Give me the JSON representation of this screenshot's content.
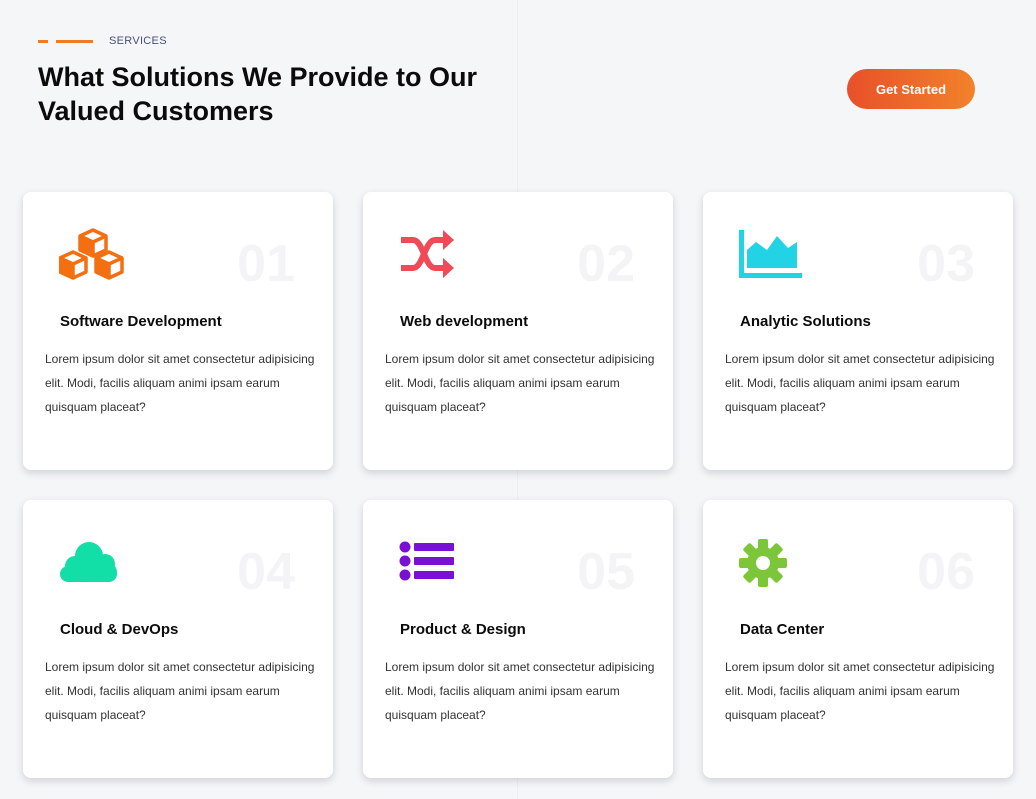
{
  "header": {
    "eyebrow": "SERVICES",
    "title": "What Solutions We Provide to Our Valued Customers",
    "cta_label": "Get Started"
  },
  "colors": {
    "accent": "#f07b22",
    "cta_gradient": [
      "#e8502a",
      "#f2822a"
    ]
  },
  "services": [
    {
      "number": "01",
      "title": "Software Development",
      "description": "Lorem ipsum dolor sit amet consectetur adipisicing elit. Modi, facilis aliquam animi ipsam earum quisquam placeat?",
      "icon": "cubes-icon",
      "icon_color": "#f36f10"
    },
    {
      "number": "02",
      "title": "Web development",
      "description": "Lorem ipsum dolor sit amet consectetur adipisicing elit. Modi, facilis aliquam animi ipsam earum quisquam placeat?",
      "icon": "shuffle-icon",
      "icon_color": "#f04a57"
    },
    {
      "number": "03",
      "title": "Analytic Solutions",
      "description": "Lorem ipsum dolor sit amet consectetur adipisicing elit. Modi, facilis aliquam animi ipsam earum quisquam placeat?",
      "icon": "area-chart-icon",
      "icon_color": "#22d3e6"
    },
    {
      "number": "04",
      "title": "Cloud & DevOps",
      "description": "Lorem ipsum dolor sit amet consectetur adipisicing elit. Modi, facilis aliquam animi ipsam earum quisquam placeat?",
      "icon": "cloud-icon",
      "icon_color": "#12dfa8"
    },
    {
      "number": "05",
      "title": "Product & Design",
      "description": "Lorem ipsum dolor sit amet consectetur adipisicing elit. Modi, facilis aliquam animi ipsam earum quisquam placeat?",
      "icon": "list-icon",
      "icon_color": "#7a0fd6"
    },
    {
      "number": "06",
      "title": "Data Center",
      "description": "Lorem ipsum dolor sit amet consectetur adipisicing elit. Modi, facilis aliquam animi ipsam earum quisquam placeat?",
      "icon": "gear-icon",
      "icon_color": "#7cc63a"
    }
  ]
}
